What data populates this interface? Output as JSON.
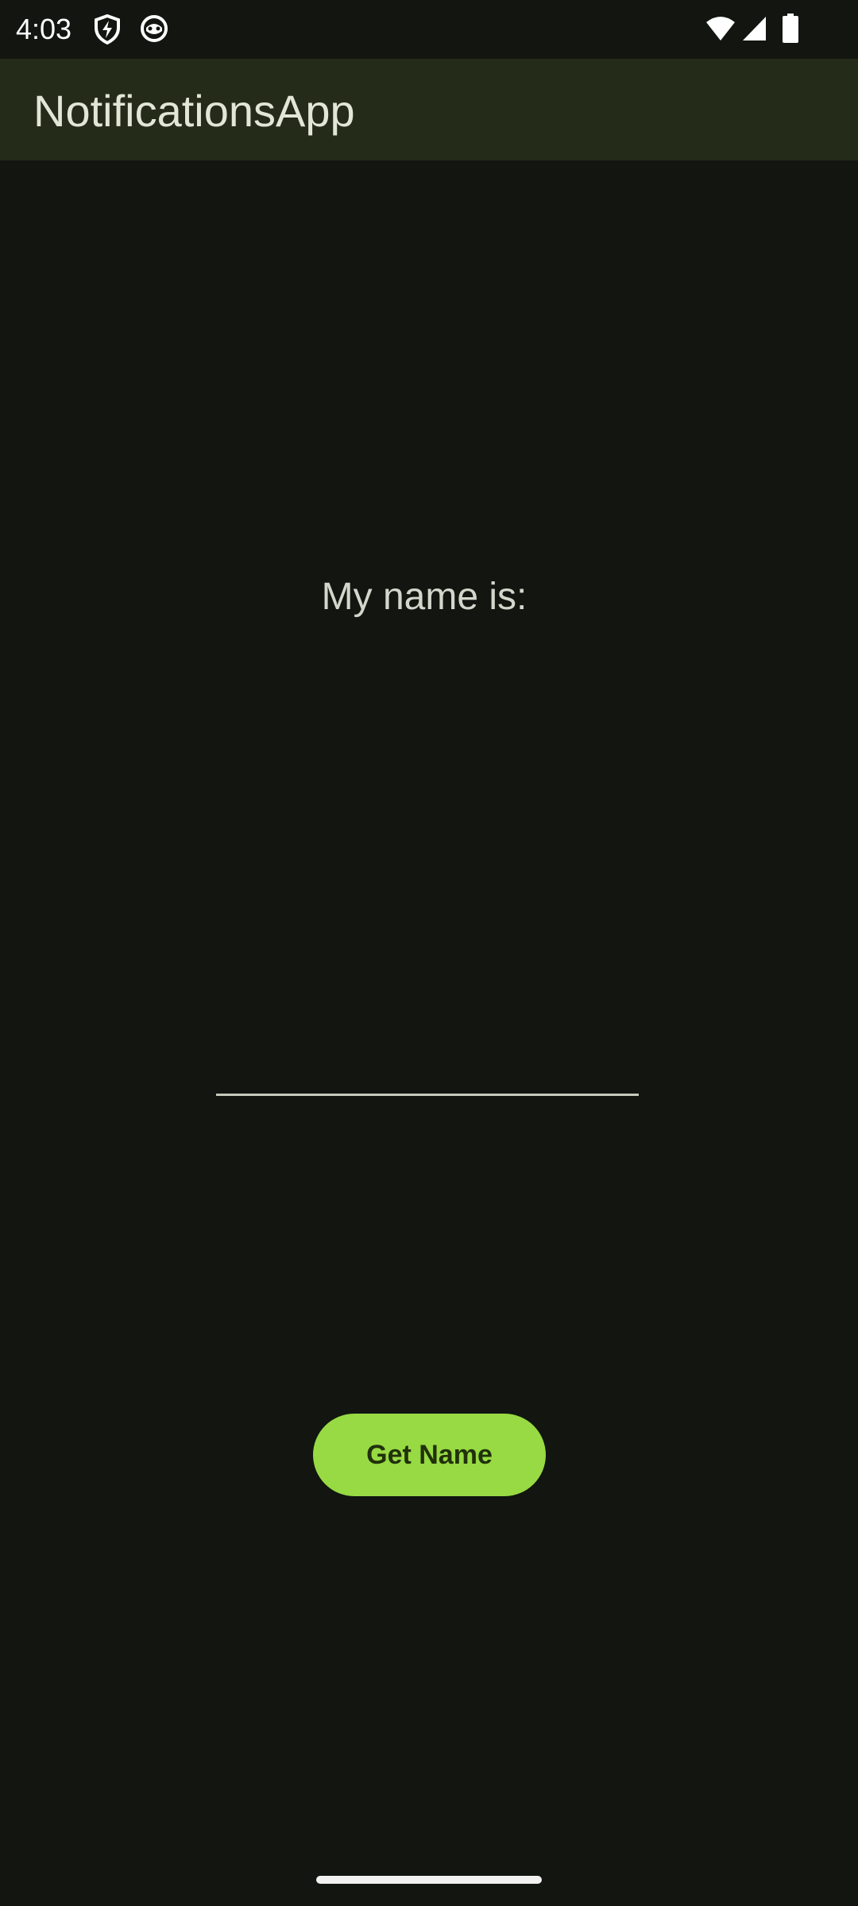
{
  "status_bar": {
    "time": "4:03",
    "left_icons": [
      "shield-icon",
      "cat-face-icon"
    ],
    "right_icons": [
      "wifi-icon",
      "cell-signal-icon",
      "battery-icon"
    ]
  },
  "app_bar": {
    "title": "NotificationsApp",
    "background_color": "#252b19"
  },
  "main": {
    "label": "My name is:",
    "name_field": {
      "value": "",
      "placeholder": ""
    },
    "get_name_button": {
      "label": "Get Name",
      "color": "#97da43"
    }
  },
  "colors": {
    "background": "#121510",
    "text": "#d3d7cb",
    "accent": "#97da43"
  }
}
